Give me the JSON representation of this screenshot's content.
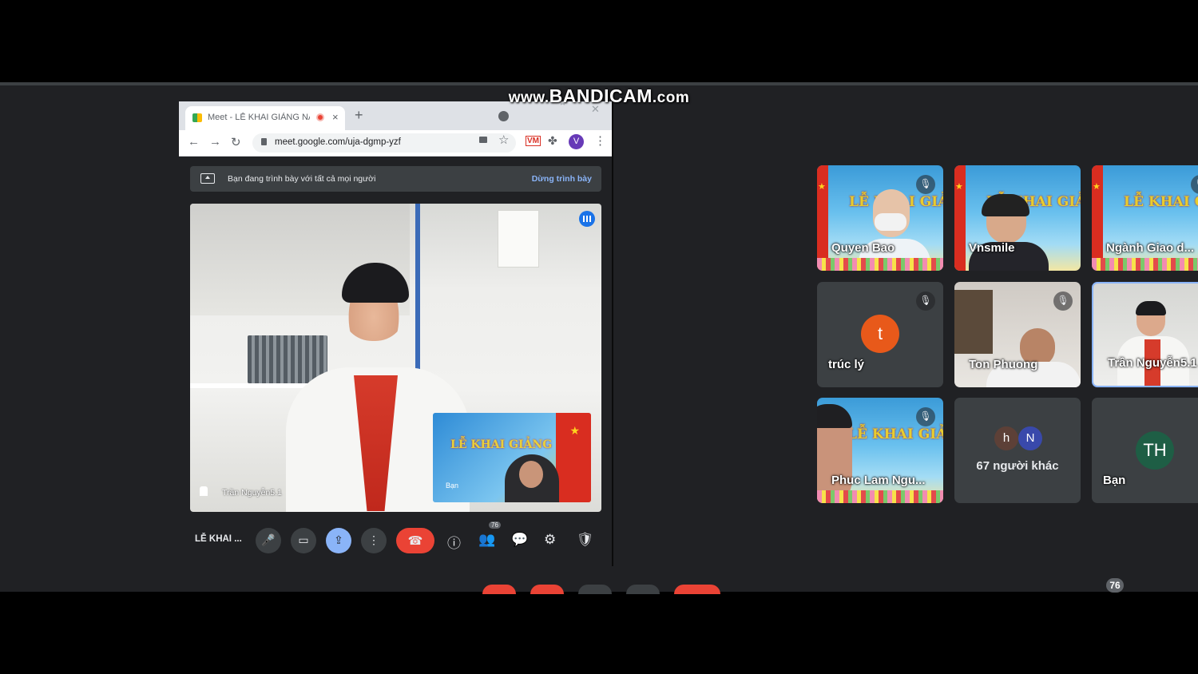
{
  "watermark": {
    "prefix": "www.",
    "brand": "BANDICAM",
    "suffix": ".com"
  },
  "browser": {
    "tab_title": "Meet - LỄ KHAI GIẢNG NĂM",
    "tab_close": "×",
    "new_tab": "+",
    "url": "meet.google.com/uja-dgmp-yzf",
    "profile_initial": "V",
    "ext_label": "VM"
  },
  "presenting_banner": {
    "text": "Bạn đang trình bày với tất cả mọi người",
    "stop_label": "Dừng trình bày"
  },
  "main_video": {
    "participant_name": "Trần Nguyễn5.1",
    "pip_name": "Bạn",
    "pip_title": "LỄ KHAI GIẢNG"
  },
  "meet_toolbar": {
    "meeting_title": "LỄ KHAI ...",
    "participants_count": "76",
    "icons": {
      "mic": "🎤",
      "camera": "▭",
      "present": "⇪",
      "more": "⋮",
      "end": "☎",
      "info": "ⓘ",
      "people": "👥",
      "chat": "💬",
      "activities": "⚙",
      "host": "🛡"
    }
  },
  "tiles": [
    {
      "name": "Quyen Bao",
      "muted": true
    },
    {
      "name": "Vnsmile",
      "muted": false
    },
    {
      "name": "Ngành Giao d...",
      "muted": true
    },
    {
      "name": "trúc lý",
      "muted": true,
      "avatar": "t"
    },
    {
      "name": "Ton Phuong",
      "muted": true
    },
    {
      "name": "Trần Nguyễn5.1",
      "muted": false
    },
    {
      "name": "Phuc Lam Ngu...",
      "muted": true
    },
    {
      "more_text": "67 người khác",
      "avatars": [
        "h",
        "N"
      ]
    },
    {
      "name": "Bạn",
      "muted": true,
      "avatar": "TH"
    }
  ],
  "poster_text": "LỄ KHAI GIẢNG",
  "bottom_badge": "76",
  "mute_glyph": "🎙"
}
